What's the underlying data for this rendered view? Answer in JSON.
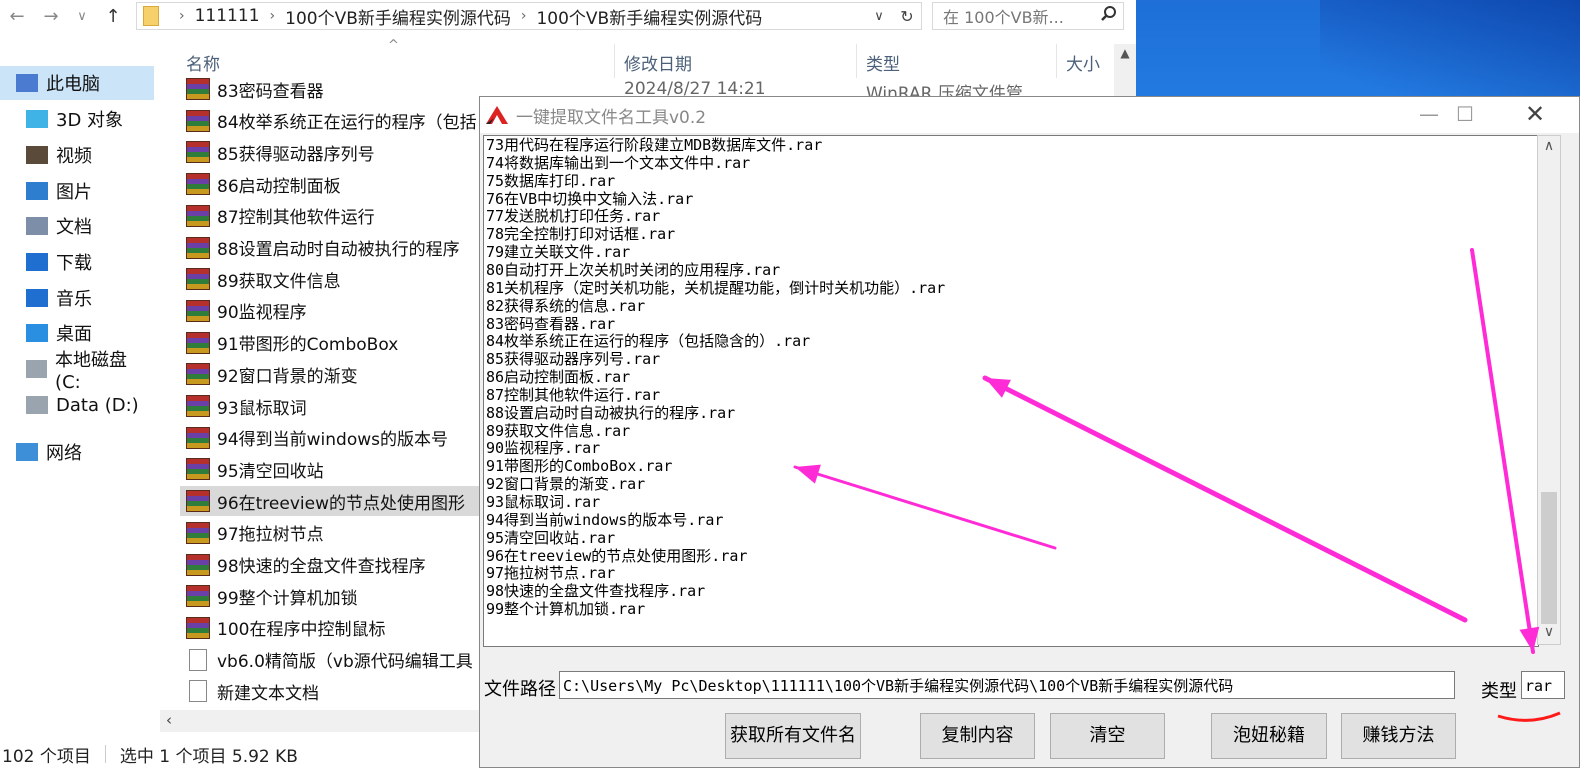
{
  "explorer": {
    "breadcrumb": [
      "111111",
      "100个VB新手编程实例源代码",
      "100个VB新手编程实例源代码"
    ],
    "search_placeholder": "在 100个VB新...",
    "columns": {
      "name": "名称",
      "modified": "修改日期",
      "type": "类型",
      "size": "大小"
    },
    "first_row_date": "2024/8/27 14:21",
    "first_row_type": "WinRAR 压缩文件管...",
    "sidebar": [
      {
        "label": "此电脑",
        "icon": "computer-icon",
        "selected": true
      },
      {
        "label": "3D 对象",
        "icon": "cube-icon"
      },
      {
        "label": "视频",
        "icon": "video-icon"
      },
      {
        "label": "图片",
        "icon": "picture-icon"
      },
      {
        "label": "文档",
        "icon": "document-icon"
      },
      {
        "label": "下载",
        "icon": "download-icon"
      },
      {
        "label": "音乐",
        "icon": "music-icon"
      },
      {
        "label": "桌面",
        "icon": "desktop-icon"
      },
      {
        "label": "本地磁盘 (C:",
        "icon": "drive-icon"
      },
      {
        "label": "Data (D:)",
        "icon": "drive-icon"
      },
      {
        "label": "网络",
        "icon": "network-icon"
      }
    ],
    "files": [
      {
        "name": "83密码查看器",
        "icon": "rar"
      },
      {
        "name": "84枚举系统正在运行的程序（包括",
        "icon": "rar"
      },
      {
        "name": "85获得驱动器序列号",
        "icon": "rar"
      },
      {
        "name": "86启动控制面板",
        "icon": "rar"
      },
      {
        "name": "87控制其他软件运行",
        "icon": "rar"
      },
      {
        "name": "88设置启动时自动被执行的程序",
        "icon": "rar"
      },
      {
        "name": "89获取文件信息",
        "icon": "rar"
      },
      {
        "name": "90监视程序",
        "icon": "rar"
      },
      {
        "name": "91带图形的ComboBox",
        "icon": "rar"
      },
      {
        "name": "92窗口背景的渐变",
        "icon": "rar"
      },
      {
        "name": "93鼠标取词",
        "icon": "rar"
      },
      {
        "name": "94得到当前windows的版本号",
        "icon": "rar"
      },
      {
        "name": "95清空回收站",
        "icon": "rar"
      },
      {
        "name": "96在treeview的节点处使用图形",
        "icon": "rar",
        "selected": true
      },
      {
        "name": "97拖拉树节点",
        "icon": "rar"
      },
      {
        "name": "98快速的全盘文件查找程序",
        "icon": "rar"
      },
      {
        "name": "99整个计算机加锁",
        "icon": "rar"
      },
      {
        "name": "100在程序中控制鼠标",
        "icon": "rar"
      },
      {
        "name": "vb6.0精简版（vb源代码编辑工具",
        "icon": "txt"
      },
      {
        "name": "新建文本文档",
        "icon": "txt"
      }
    ],
    "status": {
      "count": "102 个项目",
      "selection": "选中 1 个项目  5.92 KB"
    }
  },
  "tool": {
    "title": "一键提取文件名工具v0.2",
    "lines": [
      "73用代码在程序运行阶段建立MDB数据库文件.rar",
      "74将数据库输出到一个文本文件中.rar",
      "75数据库打印.rar",
      "76在VB中切换中文输入法.rar",
      "77发送脱机打印任务.rar",
      "78完全控制打印对话框.rar",
      "79建立关联文件.rar",
      "80自动打开上次关机时关闭的应用程序.rar",
      "81关机程序（定时关机功能，关机提醒功能，倒计时关机功能）.rar",
      "82获得系统的信息.rar",
      "83密码查看器.rar",
      "84枚举系统正在运行的程序（包括隐含的）.rar",
      "85获得驱动器序列号.rar",
      "86启动控制面板.rar",
      "87控制其他软件运行.rar",
      "88设置启动时自动被执行的程序.rar",
      "89获取文件信息.rar",
      "90监视程序.rar",
      "91带图形的ComboBox.rar",
      "92窗口背景的渐变.rar",
      "93鼠标取词.rar",
      "94得到当前windows的版本号.rar",
      "95清空回收站.rar",
      "96在treeview的节点处使用图形.rar",
      "97拖拉树节点.rar",
      "98快速的全盘文件查找程序.rar",
      "99整个计算机加锁.rar"
    ],
    "path_label": "文件路径",
    "path_value": "C:\\Users\\My Pc\\Desktop\\111111\\100个VB新手编程实例源代码\\100个VB新手编程实例源代码",
    "type_label": "类型",
    "type_value": "rar",
    "buttons": [
      "获取所有文件名",
      "复制内容",
      "清空",
      "泡妞秘籍",
      "赚钱方法"
    ]
  },
  "annotations": {
    "arrow_color": "#ff2bd6",
    "underline_color": "#ff1a1a"
  }
}
